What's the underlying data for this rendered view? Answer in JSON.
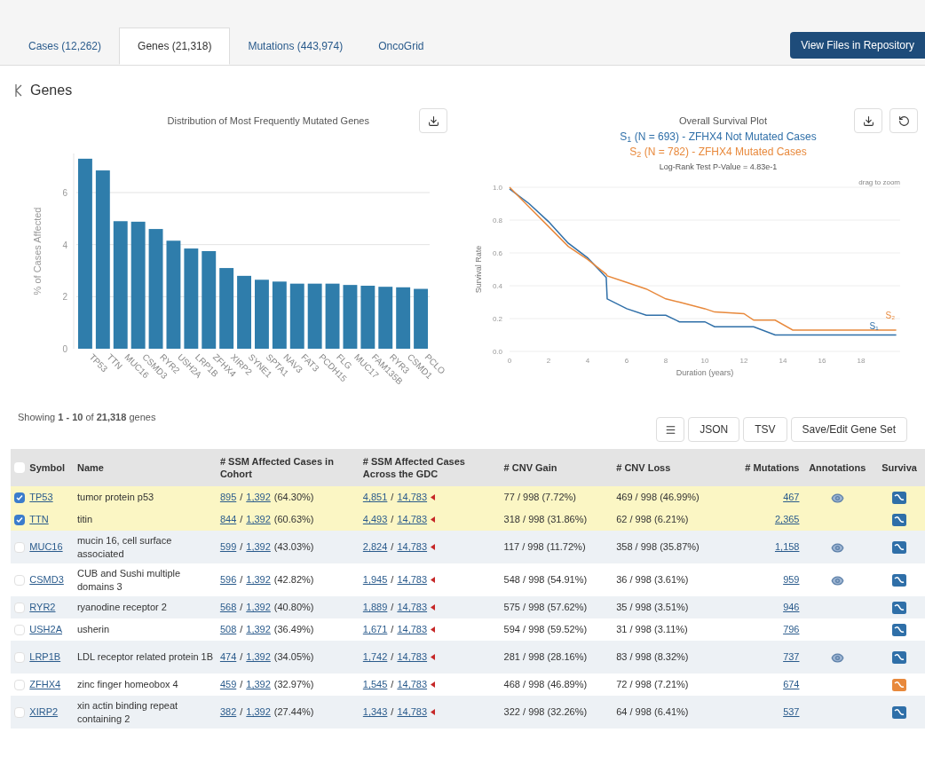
{
  "tabs": [
    {
      "label": "Cases (12,262)",
      "selected": false
    },
    {
      "label": "Genes (21,318)",
      "selected": true
    },
    {
      "label": "Mutations (443,974)",
      "selected": false
    },
    {
      "label": "OncoGrid",
      "selected": false
    }
  ],
  "repository_button": "View Files in Repository",
  "heading": "Genes",
  "bar_panel": {
    "title": "Distribution of Most Frequently Mutated Genes",
    "chart_data": {
      "type": "bar",
      "ylabel": "% of Cases Affected",
      "categories": [
        "TP53",
        "TTN",
        "MUC16",
        "CSMD3",
        "RYR2",
        "USH2A",
        "LRP1B",
        "ZFHX4",
        "XIRP2",
        "SYNE1",
        "SPTA1",
        "NAV3",
        "FAT3",
        "PCDH15",
        "FLG",
        "MUC17",
        "FAM135B",
        "RYR3",
        "CSMD1",
        "PCLO"
      ],
      "series": [
        {
          "color": "#2f7dab",
          "values": [
            7.3,
            6.85,
            4.9,
            4.88,
            4.6,
            4.15,
            3.85,
            3.75,
            3.1,
            2.8,
            2.65,
            2.58,
            2.5,
            2.5,
            2.5,
            2.45,
            2.42,
            2.38,
            2.36,
            2.3
          ]
        }
      ],
      "ylim": [
        0,
        7.5
      ],
      "yticks": [
        0,
        2,
        4,
        6
      ],
      "grid": true
    }
  },
  "survival_panel": {
    "title": "Overall Survival Plot",
    "legend": [
      "S$_{1}$ (N = 693) - ZFHX4 Not Mutated Cases",
      "S$_{2}$ (N = 782) - ZFHX4 Mutated Cases"
    ],
    "pvalue": "Log-Rank Test P-Value = 4.83e-1",
    "hint": "drag to zoom",
    "chart_data": {
      "type": "line",
      "xlabel": "Duration (years)",
      "ylabel": "Survival Rate",
      "x": [
        0,
        1,
        2,
        3,
        4,
        4.95,
        5,
        6,
        7,
        8,
        8.7,
        10,
        10.5,
        12,
        12.5,
        13.6,
        14.5,
        16,
        18,
        19.8
      ],
      "series": [
        {
          "name": "S₁",
          "color": "#2f6fa8",
          "values": [
            0.99,
            0.9,
            0.79,
            0.66,
            0.57,
            0.45,
            0.32,
            0.26,
            0.22,
            0.22,
            0.18,
            0.18,
            0.15,
            0.15,
            0.15,
            0.1,
            0.1,
            0.1,
            0.1,
            0.1
          ]
        },
        {
          "name": "S₂",
          "color": "#e8893c",
          "values": [
            1.0,
            0.88,
            0.76,
            0.64,
            0.56,
            0.47,
            0.46,
            0.42,
            0.38,
            0.32,
            0.3,
            0.26,
            0.24,
            0.23,
            0.19,
            0.19,
            0.13,
            0.13,
            0.13,
            0.13
          ]
        }
      ],
      "grid": true,
      "xlim": [
        0,
        20
      ],
      "ylim": [
        0,
        1
      ],
      "xticks": [
        0,
        2,
        4,
        6,
        8,
        10,
        12,
        14,
        16,
        18
      ],
      "yticks": [
        {
          "value": 0,
          "label": "0.0"
        },
        {
          "value": 0.2,
          "label": "0.2"
        },
        {
          "value": 0.4,
          "label": "0.4"
        },
        {
          "value": 0.6,
          "label": "0.6"
        },
        {
          "value": 0.8,
          "label": "0.8"
        },
        {
          "value": 1,
          "label": "1.0"
        }
      ]
    }
  },
  "showing": "Showing **1 - 10** of **21,318** genes",
  "table_buttons": [
    {
      "kind": "menu"
    },
    {
      "kind": "text",
      "label": "JSON"
    },
    {
      "kind": "text",
      "label": "TSV"
    },
    {
      "kind": "text",
      "label": "Save/Edit Gene Set"
    }
  ],
  "table": {
    "select_all": {
      "checked": false
    },
    "columns": [
      "Symbol",
      "Name",
      "# SSM Affected Cases in Cohort",
      "# SSM Affected Cases Across the GDC",
      "# CNV Gain",
      "# CNV Loss",
      "# Mutations",
      "Annotations",
      "Surviva"
    ],
    "rows": [
      {
        "checked": true,
        "symbol": "TP53",
        "name": "tumor protein p53",
        "cohort": [
          "895",
          "/",
          "1,392",
          "(64.30%)"
        ],
        "gdc": [
          "4,851",
          "/",
          "14,783"
        ],
        "cnv_gain": "77 / 998 (7.72%)",
        "cnv_loss": "469 / 998 (46.99%)",
        "mutations": "467",
        "annotated": true,
        "plotted": false
      },
      {
        "checked": true,
        "symbol": "TTN",
        "name": "titin",
        "cohort": [
          "844",
          "/",
          "1,392",
          "(60.63%)"
        ],
        "gdc": [
          "4,493",
          "/",
          "14,783"
        ],
        "cnv_gain": "318 / 998 (31.86%)",
        "cnv_loss": "62 / 998 (6.21%)",
        "mutations": "2,365",
        "annotated": false,
        "plotted": false
      },
      {
        "checked": false,
        "symbol": "MUC16",
        "name": "mucin 16, cell surface associated",
        "cohort": [
          "599",
          "/",
          "1,392",
          "(43.03%)"
        ],
        "gdc": [
          "2,824",
          "/",
          "14,783"
        ],
        "cnv_gain": "117 / 998 (11.72%)",
        "cnv_loss": "358 / 998 (35.87%)",
        "mutations": "1,158",
        "annotated": true,
        "plotted": false
      },
      {
        "checked": false,
        "symbol": "CSMD3",
        "name": "CUB and Sushi multiple domains 3",
        "cohort": [
          "596",
          "/",
          "1,392",
          "(42.82%)"
        ],
        "gdc": [
          "1,945",
          "/",
          "14,783"
        ],
        "cnv_gain": "548 / 998 (54.91%)",
        "cnv_loss": "36 / 998 (3.61%)",
        "mutations": "959",
        "annotated": true,
        "plotted": false
      },
      {
        "checked": false,
        "symbol": "RYR2",
        "name": "ryanodine receptor 2",
        "cohort": [
          "568",
          "/",
          "1,392",
          "(40.80%)"
        ],
        "gdc": [
          "1,889",
          "/",
          "14,783"
        ],
        "cnv_gain": "575 / 998 (57.62%)",
        "cnv_loss": "35 / 998 (3.51%)",
        "mutations": "946",
        "annotated": false,
        "plotted": false
      },
      {
        "checked": false,
        "symbol": "USH2A",
        "name": "usherin",
        "cohort": [
          "508",
          "/",
          "1,392",
          "(36.49%)"
        ],
        "gdc": [
          "1,671",
          "/",
          "14,783"
        ],
        "cnv_gain": "594 / 998 (59.52%)",
        "cnv_loss": "31 / 998 (3.11%)",
        "mutations": "796",
        "annotated": false,
        "plotted": false
      },
      {
        "checked": false,
        "symbol": "LRP1B",
        "name": "LDL receptor related protein 1B",
        "cohort": [
          "474",
          "/",
          "1,392",
          "(34.05%)"
        ],
        "gdc": [
          "1,742",
          "/",
          "14,783"
        ],
        "cnv_gain": "281 / 998 (28.16%)",
        "cnv_loss": "83 / 998 (8.32%)",
        "mutations": "737",
        "annotated": true,
        "plotted": false
      },
      {
        "checked": false,
        "symbol": "ZFHX4",
        "name": "zinc finger homeobox 4",
        "cohort": [
          "459",
          "/",
          "1,392",
          "(32.97%)"
        ],
        "gdc": [
          "1,545",
          "/",
          "14,783"
        ],
        "cnv_gain": "468 / 998 (46.89%)",
        "cnv_loss": "72 / 998 (7.21%)",
        "mutations": "674",
        "annotated": false,
        "plotted": true
      },
      {
        "checked": false,
        "symbol": "XIRP2",
        "name": "xin actin binding repeat containing 2",
        "cohort": [
          "382",
          "/",
          "1,392",
          "(27.44%)"
        ],
        "gdc": [
          "1,343",
          "/",
          "14,783"
        ],
        "cnv_gain": "322 / 998 (32.26%)",
        "cnv_loss": "64 / 998 (6.41%)",
        "mutations": "537",
        "annotated": false,
        "plotted": false
      }
    ]
  }
}
